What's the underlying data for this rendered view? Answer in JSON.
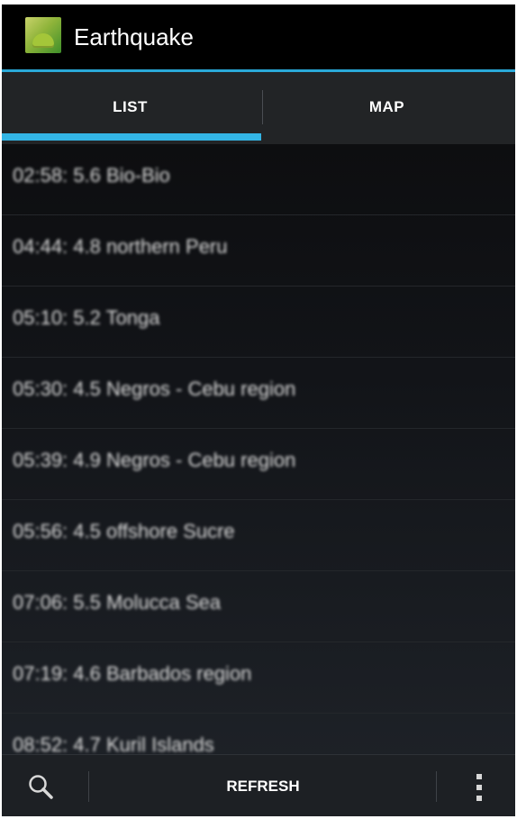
{
  "app": {
    "title": "Earthquake",
    "icon": "android-app-icon"
  },
  "tabs": [
    {
      "label": "LIST",
      "selected": true
    },
    {
      "label": "MAP",
      "selected": false
    }
  ],
  "earthquakes": [
    "02:58: 5.6 Bio-Bio",
    "04:44: 4.8 northern Peru",
    "05:10: 5.2 Tonga",
    "05:30: 4.5 Negros - Cebu region",
    "05:39: 4.9 Negros - Cebu region",
    "05:56: 4.5 offshore Sucre",
    "07:06: 5.5 Molucca Sea",
    "07:19: 4.6 Barbados region",
    "08:52: 4.7 Kuril Islands"
  ],
  "bottom_bar": {
    "search_icon": "search-icon",
    "refresh_label": "REFRESH",
    "overflow_icon": "overflow-menu-icon"
  },
  "colors": {
    "accent": "#33b5e5",
    "background": "#0a0a0b",
    "text": "#ffffff"
  }
}
